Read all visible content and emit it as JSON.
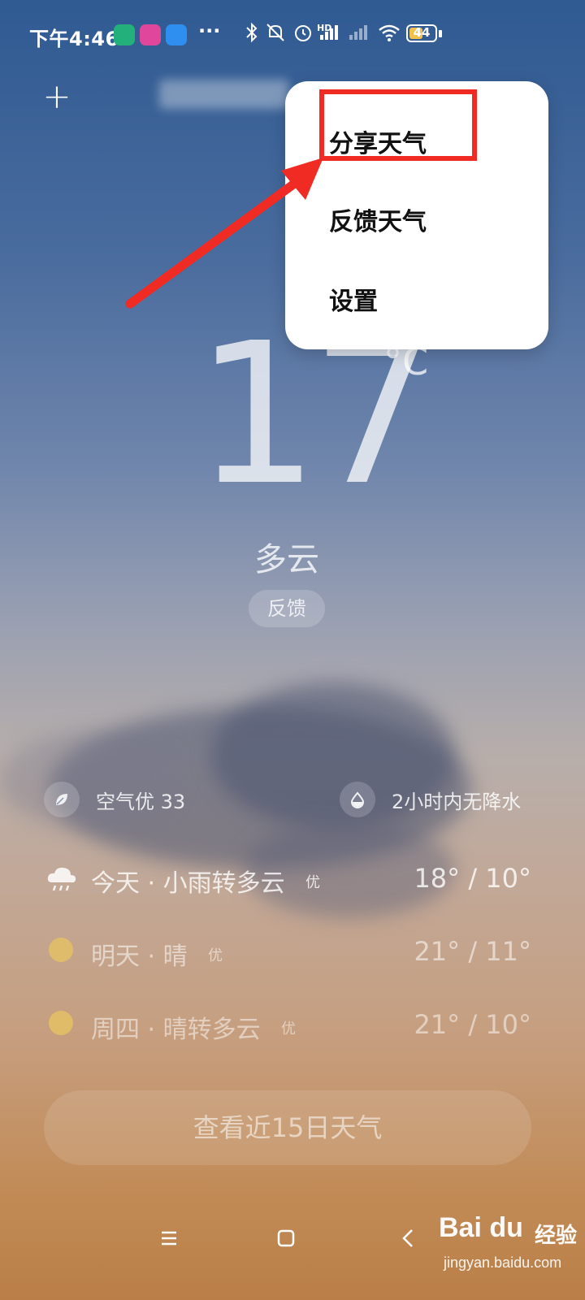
{
  "status_bar": {
    "time": "下午4:46",
    "more": "···",
    "network": "HD",
    "battery": "44",
    "icons": [
      "shield-app-icon",
      "pink-app-icon",
      "blue-app-icon",
      "bluetooth-icon",
      "mute-icon",
      "alarm-icon",
      "signal-hd-icon",
      "signal-icon",
      "wifi-icon",
      "battery-icon"
    ]
  },
  "header": {
    "add_label": "+"
  },
  "weather": {
    "temperature": "17",
    "unit": "°C",
    "condition": "多云",
    "feedback": "反馈"
  },
  "info": {
    "air_quality": "空气优 33",
    "precipitation": "2小时内无降水"
  },
  "forecast": [
    {
      "label": "今天 · 小雨转多云",
      "quality": "优",
      "temps": "18° / 10°",
      "icon": "rain-cloud-icon"
    },
    {
      "label": "明天 · 晴",
      "quality": "优",
      "temps": "21° / 11°",
      "icon": "sun-icon"
    },
    {
      "label": "周四 · 晴转多云",
      "quality": "优",
      "temps": "21° / 10°",
      "icon": "sun-icon"
    }
  ],
  "forecast_button": "查看近15日天气",
  "menu": {
    "items": [
      "分享天气",
      "反馈天气",
      "设置"
    ]
  },
  "watermark": {
    "logo": "Bai du",
    "brand": "经验",
    "url": "jingyan.baidu.com"
  },
  "colors": {
    "highlight": "#ef2b24",
    "menu_bg": "#ffffff",
    "sky_top": "#2f5a92",
    "sky_bottom": "#ba7f48"
  }
}
